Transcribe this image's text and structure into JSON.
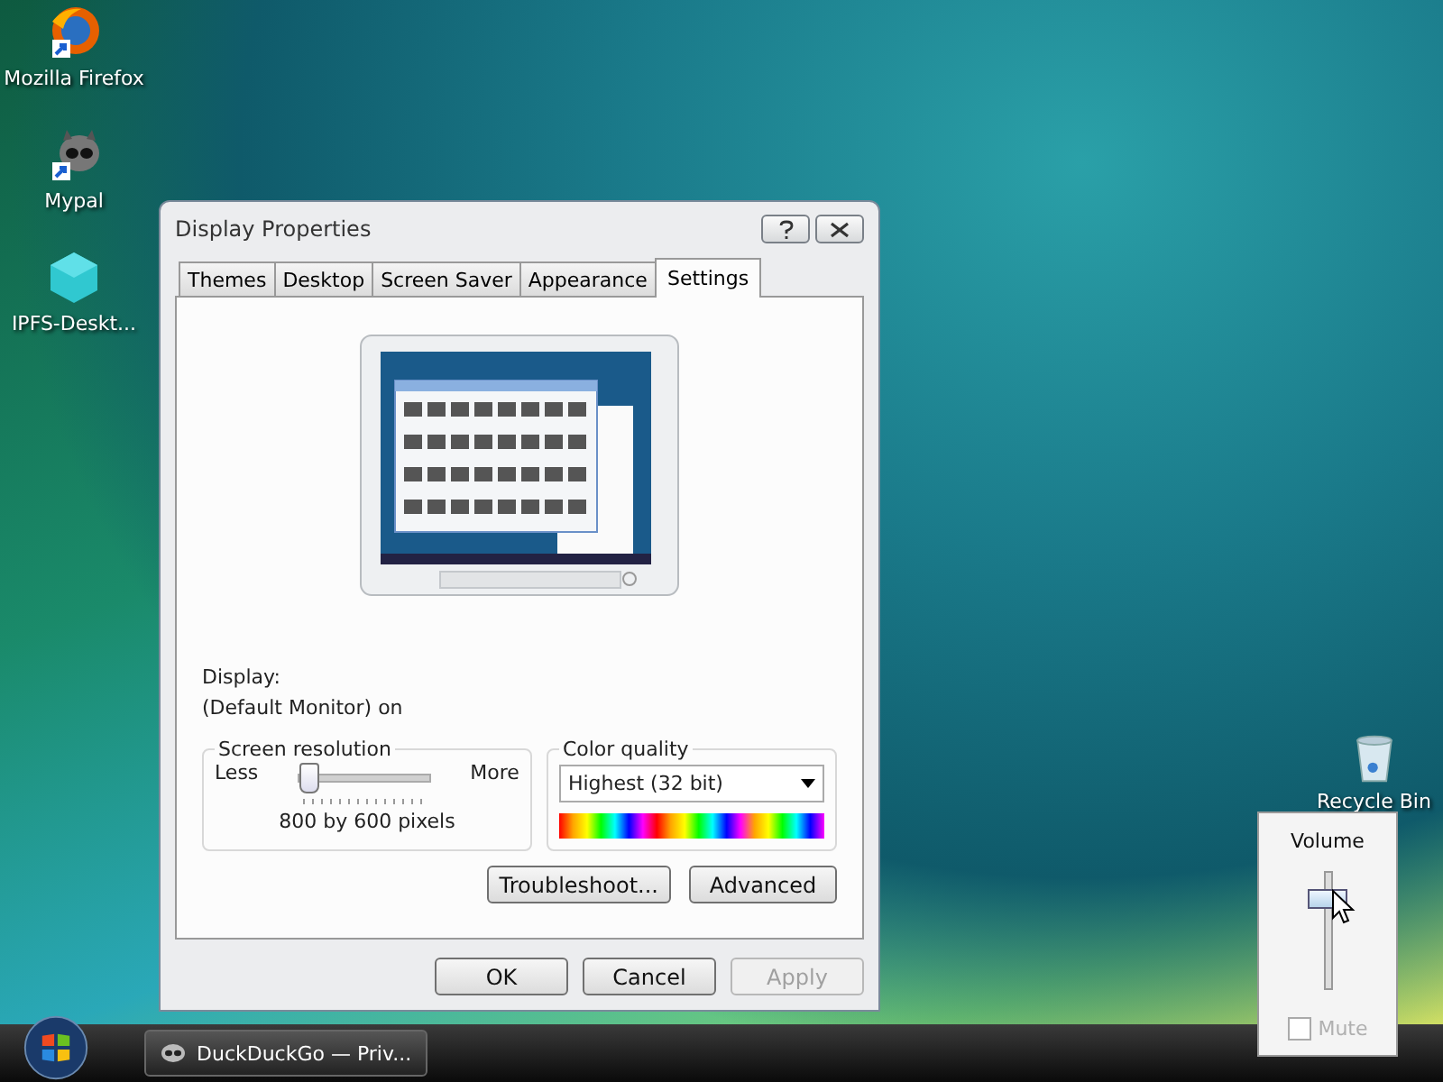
{
  "desktop_icons": [
    {
      "label": "Mozilla Firefox",
      "kind": "firefox"
    },
    {
      "label": "Mypal",
      "kind": "mypal"
    },
    {
      "label": "IPFS-Deskt...",
      "kind": "cube"
    }
  ],
  "recycle_bin": {
    "label": "Recycle Bin"
  },
  "window": {
    "title": "Display Properties"
  },
  "tabs": [
    {
      "label": "Themes",
      "selected": false
    },
    {
      "label": "Desktop",
      "selected": false
    },
    {
      "label": "Screen Saver",
      "selected": false
    },
    {
      "label": "Appearance",
      "selected": false
    },
    {
      "label": "Settings",
      "selected": true
    }
  ],
  "display": {
    "label": "Display:",
    "value": "(Default Monitor) on"
  },
  "resolution": {
    "title": "Screen resolution",
    "less": "Less",
    "more": "More",
    "level": 0,
    "reading": "800 by 600 pixels"
  },
  "color_quality": {
    "title": "Color quality",
    "value": "Highest (32 bit)"
  },
  "panel_buttons": [
    "Troubleshoot...",
    "Advanced"
  ],
  "dialog_buttons": [
    {
      "label": "OK",
      "disabled": false
    },
    {
      "label": "Cancel",
      "disabled": false
    },
    {
      "label": "Apply",
      "disabled": true
    }
  ],
  "volume": {
    "title": "Volume",
    "level": 0.85,
    "mute": {
      "label": "Mute",
      "checked": false,
      "disabled": true
    }
  },
  "taskbar": {
    "tasks": [
      {
        "label": "DuckDuckGo — Priv..."
      }
    ]
  }
}
